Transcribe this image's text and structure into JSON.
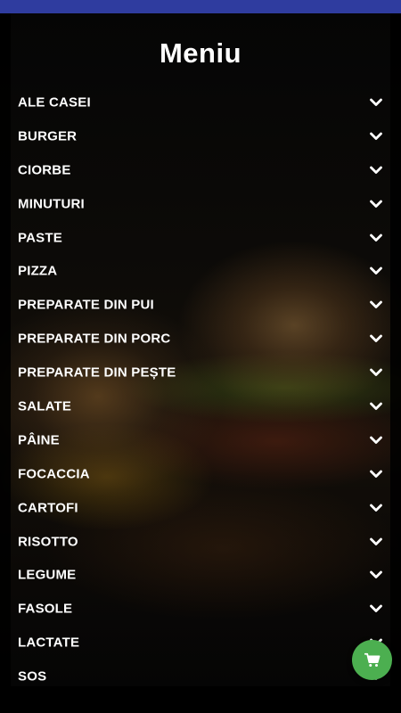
{
  "header": {
    "title": "Meniu"
  },
  "menu": {
    "items": [
      {
        "label": "ALE CASEI"
      },
      {
        "label": "BURGER"
      },
      {
        "label": "CIORBE"
      },
      {
        "label": "MINUTURI"
      },
      {
        "label": "PASTE"
      },
      {
        "label": "PIZZA"
      },
      {
        "label": "PREPARATE DIN PUI"
      },
      {
        "label": "PREPARATE DIN PORC"
      },
      {
        "label": "PREPARATE DIN PEȘTE"
      },
      {
        "label": "SALATE"
      },
      {
        "label": "PÂINE"
      },
      {
        "label": "FOCACCIA"
      },
      {
        "label": "CARTOFI"
      },
      {
        "label": "RISOTTO"
      },
      {
        "label": "LEGUME"
      },
      {
        "label": "FASOLE"
      },
      {
        "label": "LACTATE"
      },
      {
        "label": "SOS"
      }
    ],
    "expand_icon": "chevron-down-icon"
  },
  "cart_button": {
    "icon": "shopping-cart-icon"
  },
  "colors": {
    "status_bar": "#2f3c9f",
    "background": "#000000",
    "text": "#ffffff",
    "cart_button": "#4caf50"
  }
}
